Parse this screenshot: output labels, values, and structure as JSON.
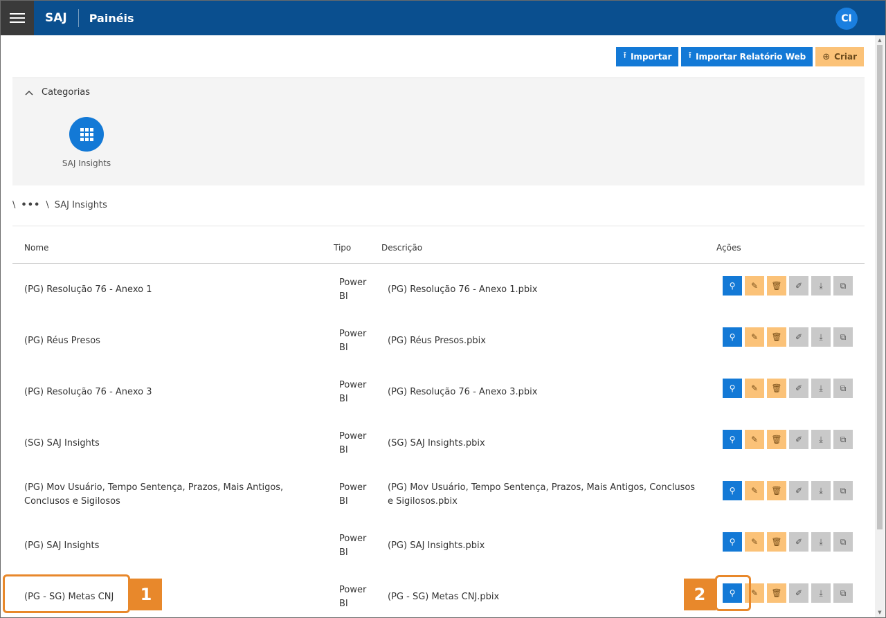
{
  "header": {
    "brand": "SAJ",
    "page_title": "Painéis",
    "avatar_initials": "CI"
  },
  "toolbar": {
    "import_label": "Importar",
    "import_web_label": "Importar Relatório Web",
    "create_label": "Criar"
  },
  "categories": {
    "title": "Categorias",
    "items": [
      {
        "label": "SAJ Insights"
      }
    ]
  },
  "breadcrumb": {
    "separator": "\\",
    "ellipsis": "•••",
    "current": "SAJ Insights"
  },
  "table": {
    "headers": {
      "name": "Nome",
      "tipo": "Tipo",
      "desc": "Descrição",
      "acoes": "Ações"
    },
    "rows": [
      {
        "name": "(PG) Resolução 76 - Anexo 1",
        "tipo": "Power BI",
        "desc": "(PG) Resolução 76 - Anexo 1.pbix"
      },
      {
        "name": "(PG) Réus Presos",
        "tipo": "Power BI",
        "desc": "(PG) Réus Presos.pbix"
      },
      {
        "name": "(PG) Resolução 76 - Anexo 3",
        "tipo": "Power BI",
        "desc": "(PG) Resolução 76 - Anexo 3.pbix"
      },
      {
        "name": "(SG) SAJ Insights",
        "tipo": "Power BI",
        "desc": "(SG) SAJ Insights.pbix"
      },
      {
        "name": "(PG) Mov Usuário, Tempo Sentença, Prazos, Mais Antigos, Conclusos e Sigilosos",
        "tipo": "Power BI",
        "desc": "(PG) Mov Usuário, Tempo Sentença, Prazos, Mais Antigos, Conclusos e Sigilosos.pbix"
      },
      {
        "name": "(PG) SAJ Insights",
        "tipo": "Power BI",
        "desc": "(PG) SAJ Insights.pbix"
      },
      {
        "name": "(PG - SG) Metas CNJ",
        "tipo": "Power BI",
        "desc": "(PG - SG) Metas CNJ.pbix"
      }
    ]
  },
  "callouts": [
    {
      "number": "1"
    },
    {
      "number": "2"
    }
  ],
  "colors": {
    "topbar": "#0a4f8f",
    "primary_button": "#1379d6",
    "create_button": "#fbc278",
    "callout": "#e8882b"
  }
}
